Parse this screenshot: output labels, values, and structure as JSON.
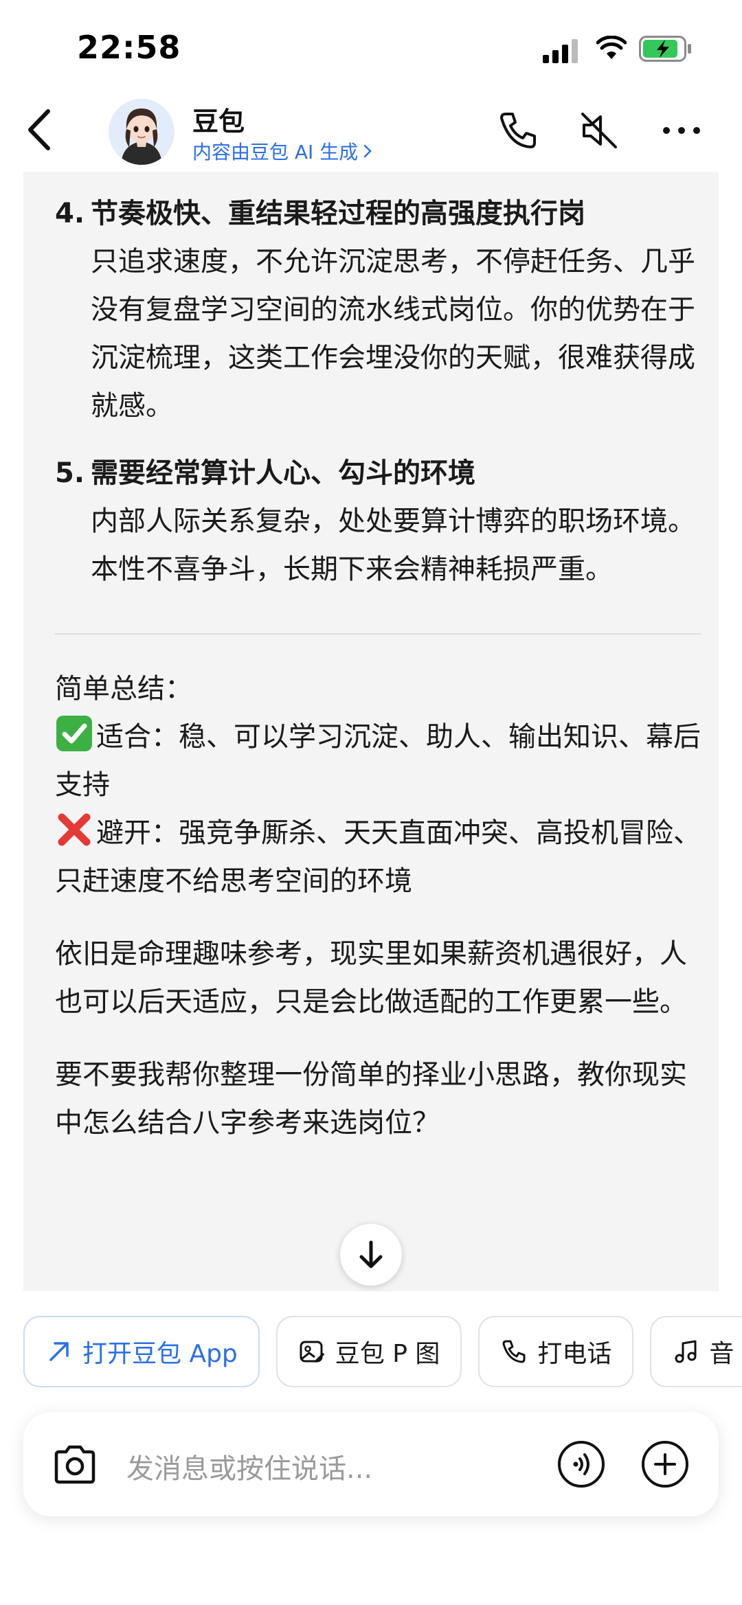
{
  "status": {
    "time": "22:58"
  },
  "header": {
    "title": "豆包",
    "subtitle": "内容由豆包 AI 生成"
  },
  "message": {
    "items": [
      {
        "num": "4.",
        "heading": "节奏极快、重结果轻过程的高强度执行岗",
        "body": "只追求速度，不允许沉淀思考，不停赶任务、几乎没有复盘学习空间的流水线式岗位。你的优势在于沉淀梳理，这类工作会埋没你的天赋，很难获得成就感。"
      },
      {
        "num": "5.",
        "heading": "需要经常算计人心、勾斗的环境",
        "body": "内部人际关系复杂，处处要算计博弈的职场环境。本性不喜争斗，长期下来会精神耗损严重。"
      }
    ],
    "summary_title": "简单总结：",
    "suitable": "适合：稳、可以学习沉淀、助人、输出知识、幕后支持",
    "avoid": "避开：强竞争厮杀、天天直面冲突、高投机冒险、只赶速度不给思考空间的环境",
    "para1": "依旧是命理趣味参考，现实里如果薪资机遇很好，人也可以后天适应，只是会比做适配的工作更累一些。",
    "para2": "要不要我帮你整理一份简单的择业小思路，教你现实中怎么结合八字参考来选岗位？"
  },
  "actions": [
    {
      "label": "打开豆包 App",
      "icon": "arrow-up-right-icon"
    },
    {
      "label": "豆包 P 图",
      "icon": "image-edit-icon"
    },
    {
      "label": "打电话",
      "icon": "phone-icon"
    },
    {
      "label": "音",
      "icon": "music-icon"
    }
  ],
  "input": {
    "placeholder": "发消息或按住说话..."
  },
  "colors": {
    "accent": "#2a6fe8",
    "panel": "#f4f4f5",
    "check": "#3cb043",
    "cross": "#e53935"
  }
}
